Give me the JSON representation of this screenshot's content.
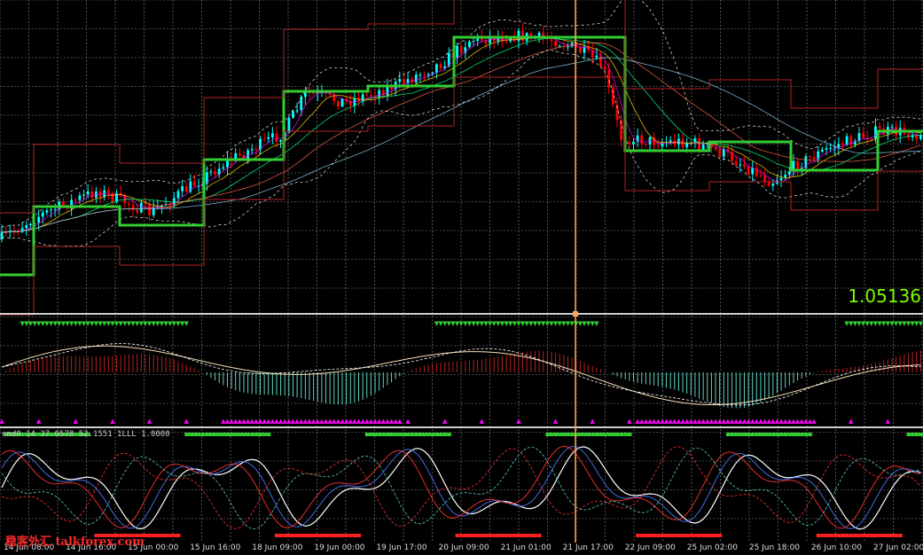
{
  "chart_data": {
    "type": "line",
    "price_readout": "1.05136",
    "indicator_label": "emd0 14 37.0578 52.1551 1LLL 1.0000",
    "watermark": "稳客外汇 talkforex.com",
    "x_tick_labels": [
      "14 Jun 08:00",
      "14 Jun 16:00",
      "15 Jun 00:00",
      "15 Jun 16:00",
      "18 Jun 09:00",
      "19 Jun 00:00",
      "19 Jun 17:00",
      "20 Jun 09:00",
      "21 Jun 01:00",
      "21 Jun 17:00",
      "22 Jun 09:00",
      "25 Jun 02:00",
      "25 Jun 18:00",
      "26 Jun 10:00",
      "27 Jun 02:00"
    ],
    "colors": {
      "background": "#000000",
      "grid": "#8a8a8a",
      "bull_candle": "#00ffff",
      "bear_candle": "#ff0000",
      "stepline": "#32cd32",
      "channel": "#b22222",
      "bands": "#ffffff",
      "cursor": "#ffa54f",
      "price_label": "#7fff00",
      "arrows_up": "#ff00ff",
      "arrows_down": "#32cd32",
      "osc_line_main": "#f5deb3",
      "stoch_white": "#ffffff",
      "stoch_blue": "#4169e1",
      "stoch_red": "#ff3030"
    }
  }
}
